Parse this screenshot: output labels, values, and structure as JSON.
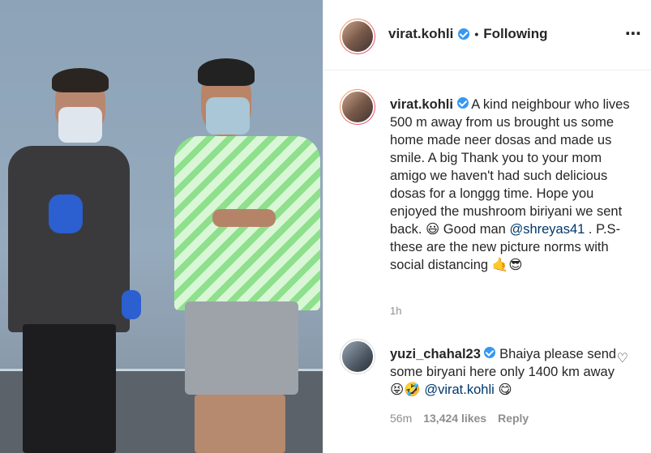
{
  "header": {
    "username": "virat.kohli",
    "separator": "•",
    "follow_status": "Following",
    "more_glyph": "⋯"
  },
  "caption": {
    "username": "virat.kohli",
    "text_part1": "A kind neighbour who lives 500 m away from us brought us some home made neer dosas and made us smile. A big Thank you to your mom amigo we haven't had such delicious dosas for a longgg time. Hope you enjoyed the mushroom biriyani we sent back. 😃 Good man",
    "mention": "@shreyas41",
    "text_part2": " . P.S- these are the new picture norms with social distancing",
    "emojis": "🤙😎",
    "time": "1h"
  },
  "comment": {
    "username": "yuzi_chahal23",
    "text": "Bhaiya please send some biryani here only 1400 km away 😝🤣",
    "mention": "@virat.kohli",
    "emoji": "😋",
    "time": "56m",
    "likes": "13,424 likes",
    "reply": "Reply",
    "heart_icon": "heart-outline-icon"
  },
  "colors": {
    "verified": "#3897f0",
    "mention": "#00376b",
    "meta": "#8e8e8e"
  }
}
